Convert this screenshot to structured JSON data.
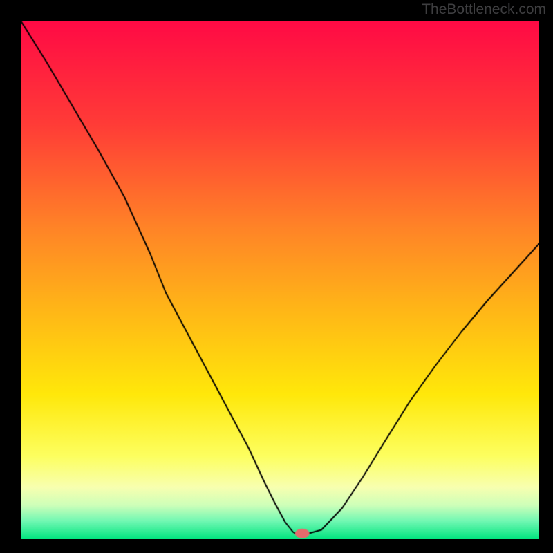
{
  "watermark": "TheBottleneck.com",
  "chart_data": {
    "type": "line",
    "title": "",
    "xlabel": "",
    "ylabel": "",
    "xlim": [
      0,
      100
    ],
    "ylim": [
      0,
      100
    ],
    "grid": false,
    "background": {
      "stops": [
        {
          "t": 0.0,
          "color": "#ff0a45"
        },
        {
          "t": 0.2,
          "color": "#ff3c37"
        },
        {
          "t": 0.4,
          "color": "#ff8427"
        },
        {
          "t": 0.55,
          "color": "#ffb418"
        },
        {
          "t": 0.72,
          "color": "#ffe80a"
        },
        {
          "t": 0.84,
          "color": "#fdff60"
        },
        {
          "t": 0.9,
          "color": "#f8ffb0"
        },
        {
          "t": 0.935,
          "color": "#cdffb9"
        },
        {
          "t": 0.965,
          "color": "#71f8b3"
        },
        {
          "t": 1.0,
          "color": "#01e57f"
        }
      ]
    },
    "series": [
      {
        "name": "bottleneck-curve",
        "color": "#000000",
        "width": 2,
        "x": [
          0,
          5,
          10,
          15,
          20,
          25,
          28,
          32,
          36,
          40,
          44,
          47,
          49,
          51,
          52.5,
          53,
          55.5,
          58,
          62,
          66,
          70,
          75,
          80,
          85,
          90,
          95,
          100
        ],
        "y": [
          100,
          92,
          83.5,
          75,
          66,
          55,
          47.5,
          40,
          32.5,
          25,
          17.5,
          11,
          7,
          3.3,
          1.4,
          1.1,
          1.1,
          1.8,
          6,
          12,
          18.5,
          26.5,
          33.5,
          40,
          46,
          51.5,
          57
        ]
      }
    ],
    "marker": {
      "x": 54.3,
      "y": 1.1,
      "rx": 1.4,
      "ry": 0.95,
      "color": "#e46b6c"
    }
  }
}
